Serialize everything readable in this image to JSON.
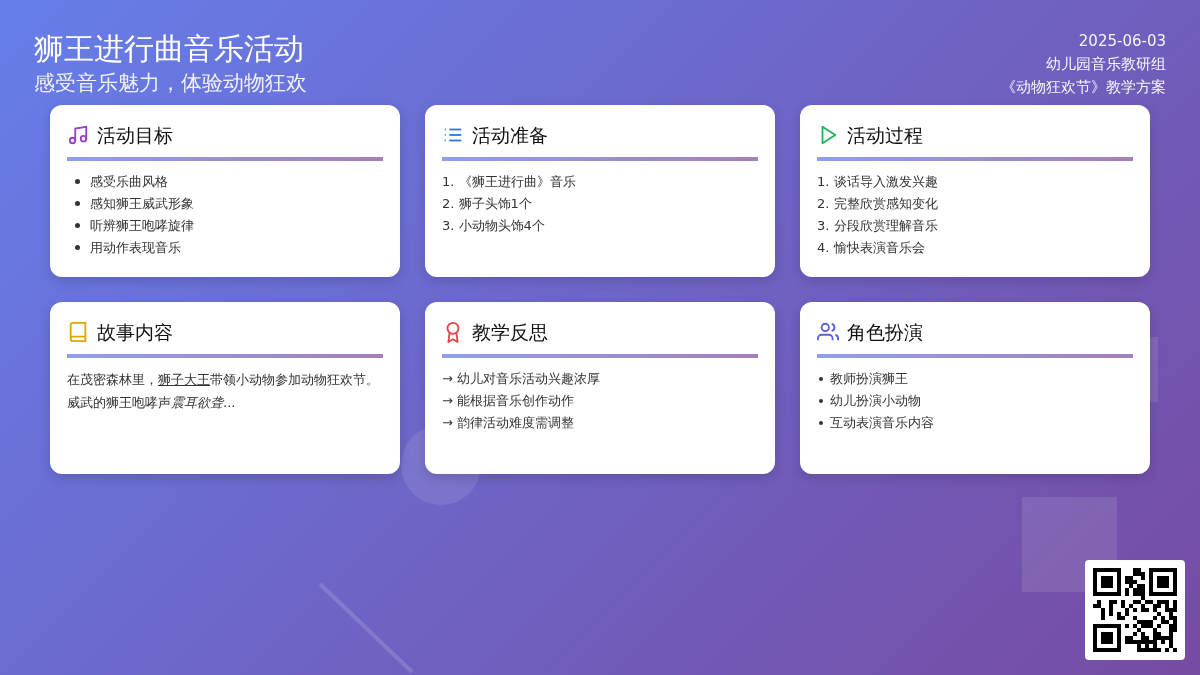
{
  "header": {
    "title": "狮王进行曲音乐活动",
    "subtitle": "感受音乐魅力，体验动物狂欢",
    "date": "2025-06-03",
    "group": "幼儿园音乐教研组",
    "plan": "《动物狂欢节》教学方案"
  },
  "cards": [
    {
      "title": "活动目标",
      "kind": "bullets",
      "items": [
        "感受乐曲风格",
        "感知狮王威武形象",
        "听辨狮王咆哮旋律",
        "用动作表现音乐"
      ]
    },
    {
      "title": "活动准备",
      "kind": "plain",
      "items": [
        "1. 《狮王进行曲》音乐",
        "2. 狮子头饰1个",
        "3. 小动物头饰4个"
      ]
    },
    {
      "title": "活动过程",
      "kind": "plain",
      "items": [
        "1. 谈话导入激发兴趣",
        "2. 完整欣赏感知变化",
        "3. 分段欣赏理解音乐",
        "4. 愉快表演音乐会"
      ]
    },
    {
      "title": "故事内容",
      "kind": "story",
      "parts": [
        {
          "text": "在茂密森林里，",
          "kind": "plain"
        },
        {
          "text": "狮子大王",
          "kind": "underline"
        },
        {
          "text": "带领小动物参加动物狂欢节。威武的狮王咆哮声",
          "kind": "plain"
        },
        {
          "text": "震耳欲聋",
          "kind": "italic"
        },
        {
          "text": "...",
          "kind": "plain"
        }
      ]
    },
    {
      "title": "教学反思",
      "kind": "plain",
      "items": [
        "→ 幼儿对音乐活动兴趣浓厚",
        "→ 能根据音乐创作动作",
        "→ 韵律活动难度需调整"
      ]
    },
    {
      "title": "角色扮演",
      "kind": "small-bullets",
      "items": [
        "教师扮演狮王",
        "幼儿扮演小动物",
        "互动表演音乐内容"
      ]
    }
  ]
}
